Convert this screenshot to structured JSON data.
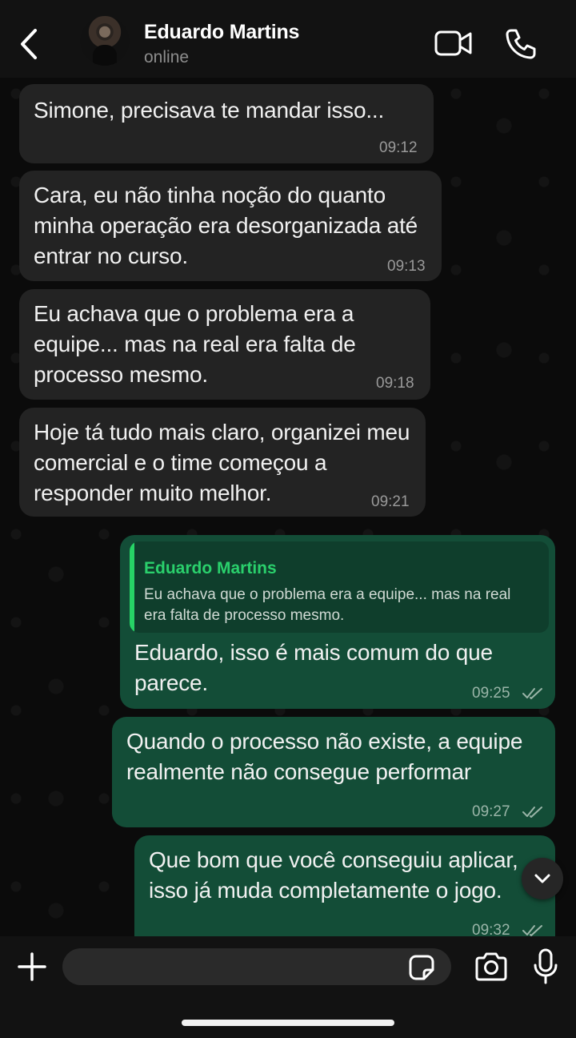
{
  "header": {
    "contact_name": "Eduardo Martins",
    "status": "online",
    "back_icon": "chevron-left-icon",
    "video_icon": "video-camera-icon",
    "call_icon": "phone-icon"
  },
  "messages": [
    {
      "direction": "in",
      "text": "Simone, precisava te mandar isso...",
      "time": "09:12"
    },
    {
      "direction": "in",
      "text": "Cara, eu não tinha noção do quanto minha operação era desorganizada até entrar no curso.",
      "time": "09:13"
    },
    {
      "direction": "in",
      "text": "Eu achava que o problema era a equipe... mas na real era falta de processo mesmo.",
      "time": "09:18"
    },
    {
      "direction": "in",
      "text": "Hoje tá tudo mais claro, organizei meu comercial e o time começou a responder muito melhor.",
      "time": "09:21"
    },
    {
      "direction": "out",
      "quote": {
        "author": "Eduardo Martins",
        "text": "Eu achava que o problema era a equipe... mas na real era falta de processo mesmo."
      },
      "text": "Eduardo, isso é mais comum do que parece.",
      "time": "09:25",
      "status": "read"
    },
    {
      "direction": "out",
      "text": "Quando o processo não existe, a equipe realmente não consegue performar",
      "time": "09:27",
      "status": "read"
    },
    {
      "direction": "out",
      "text": "Que bom que você conseguiu aplicar, isso já muda completamente o jogo.",
      "time": "09:32",
      "status": "read"
    }
  ],
  "composer": {
    "placeholder": "",
    "icons": [
      "plus-icon",
      "sticker-icon",
      "camera-icon",
      "microphone-icon"
    ]
  },
  "colors": {
    "incoming_bubble": "#232323",
    "outgoing_bubble": "#134d37",
    "quote_accent": "#27d366",
    "background": "#0b0b0b"
  }
}
